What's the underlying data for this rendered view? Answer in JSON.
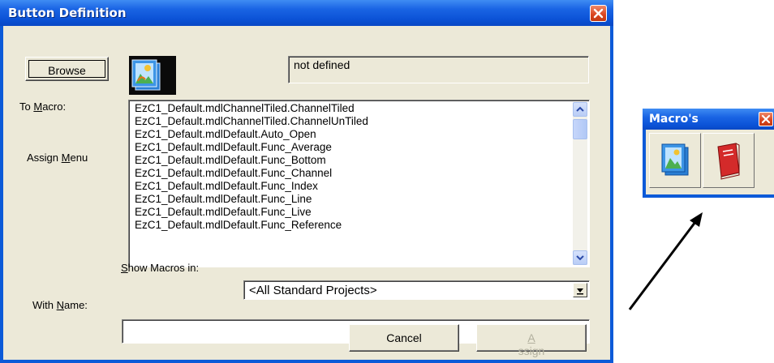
{
  "dialog": {
    "title": "Button Definition",
    "browse_label": "Browse",
    "status_text": "not defined",
    "to_macro_pre": "To ",
    "to_macro_u": "M",
    "to_macro_post": "acro:",
    "assign_menu_pre": "Assign ",
    "assign_menu_u": "M",
    "assign_menu_post": "enu",
    "macro_list": [
      "EzC1_Default.mdlChannelTiled.ChannelTiled",
      "EzC1_Default.mdlChannelTiled.ChannelUnTiled",
      "EzC1_Default.mdlDefault.Auto_Open",
      "EzC1_Default.mdlDefault.Func_Average",
      "EzC1_Default.mdlDefault.Func_Bottom",
      "EzC1_Default.mdlDefault.Func_Channel",
      "EzC1_Default.mdlDefault.Func_Index",
      "EzC1_Default.mdlDefault.Func_Line",
      "EzC1_Default.mdlDefault.Func_Live",
      "EzC1_Default.mdlDefault.Func_Reference"
    ],
    "show_macros_u": "S",
    "show_macros_post": "how Macros in:",
    "show_macros_value": "<All Standard Projects>",
    "with_name_pre": "With ",
    "with_name_u": "N",
    "with_name_post": "ame:",
    "with_name_value": "",
    "cancel_label": "Cancel",
    "assign_u": "A",
    "assign_post": "ssign"
  },
  "toolbar": {
    "title": "Macro's"
  },
  "icons": {
    "close": "close-icon",
    "preview": "picture-icon",
    "scroll_up": "chevron-up-icon",
    "scroll_down": "chevron-down-icon",
    "dropdown": "chevron-down-icon",
    "tool1": "picture-stack-icon",
    "tool2": "red-book-icon"
  },
  "colors": {
    "titlebar": "#0b52d6",
    "dialog_bg": "#ece9d8",
    "close_button": "#d9431e"
  }
}
